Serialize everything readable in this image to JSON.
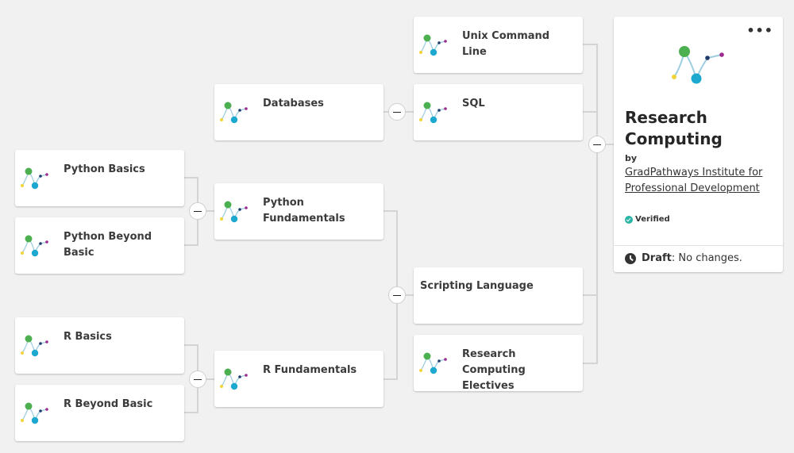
{
  "colors": {
    "background": "#f1f1f1",
    "connector": "#d4d4d4",
    "logo_green": "#4caf50",
    "logo_cyan": "#1ca8cf",
    "logo_yellow": "#f2d43a",
    "logo_navy": "#1f3b6b",
    "logo_magenta": "#9c2a8c",
    "verified": "#2bb5a5"
  },
  "nodes": {
    "python_basics": {
      "title": "Python Basics",
      "icon": "pathway-logo-icon"
    },
    "python_beyond_basic": {
      "title": "Python Beyond Basic",
      "icon": "pathway-logo-icon"
    },
    "r_basics": {
      "title": "R Basics",
      "icon": "pathway-logo-icon"
    },
    "r_beyond_basic": {
      "title": "R Beyond Basic",
      "icon": "pathway-logo-icon"
    },
    "databases": {
      "title": "Databases",
      "icon": "pathway-logo-icon"
    },
    "python_fundamentals": {
      "title": "Python Fundamentals",
      "icon": "pathway-logo-icon"
    },
    "r_fundamentals": {
      "title": "R Fundamentals",
      "icon": "pathway-logo-icon"
    },
    "unix_command_line": {
      "title": "Unix Command Line",
      "icon": "pathway-logo-icon"
    },
    "sql": {
      "title": "SQL",
      "icon": "pathway-logo-icon"
    },
    "scripting_language": {
      "title": "Scripting Language"
    },
    "research_computing_electives": {
      "title": "Research Computing Electives",
      "icon": "pathway-logo-icon"
    }
  },
  "toggles": {
    "collapse_icon": "minus-icon"
  },
  "detail": {
    "menu_label": "•••",
    "title": "Research Computing",
    "by_label": "by",
    "organization": "GradPathways Institute for Professional Development",
    "verified_label": "Verified",
    "status_label": "Draft",
    "status_separator": ":",
    "status_text": " No changes."
  }
}
